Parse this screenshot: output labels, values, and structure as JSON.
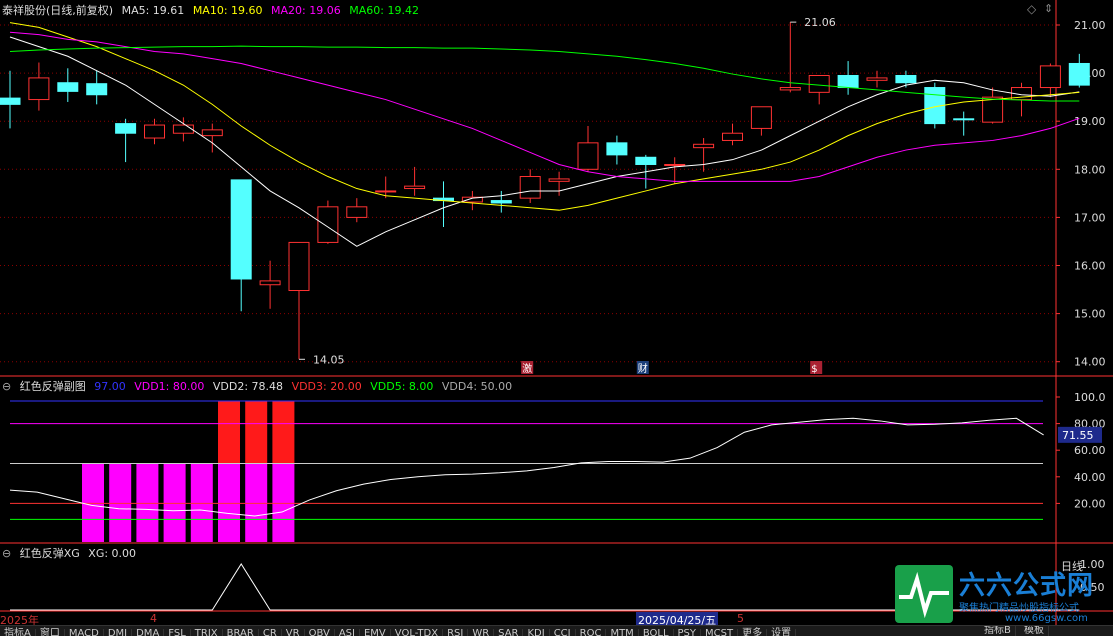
{
  "main_header": {
    "stock": "泰祥股份(日线,前复权)",
    "ma5": "MA5: 19.61",
    "ma10": "MA10: 19.60",
    "ma20": "MA20: 19.06",
    "ma60": "MA60: 19.42"
  },
  "sub1_header": {
    "name": "红色反弹副图",
    "ind1": "97.00",
    "vdd1": "VDD1: 80.00",
    "vdd2": "VDD2: 78.48",
    "vdd3": "VDD3: 20.00",
    "vdd5": "VDD5: 8.00",
    "vdd4": "VDD4: 50.00"
  },
  "sub2_header": {
    "name": "红色反弹XG",
    "xg": "XG: 0.00"
  },
  "colors": {
    "up": "#ff3232",
    "down": "#54ffff",
    "ma5": "#ffffff",
    "ma10": "#ffff00",
    "ma20": "#ff00ff",
    "ma60": "#00ff00",
    "grid": "#8b0000",
    "axis": "#ff3232"
  },
  "chart_data": [
    {
      "type": "candlestick",
      "title": "泰祥股份(日线,前复权)",
      "ylim": [
        13.8,
        21.3
      ],
      "y_ticks": [
        "21.00",
        "20.00",
        "19.00",
        "18.00",
        "17.00",
        "16.00",
        "15.00",
        "14.00"
      ],
      "candles": [
        {
          "o": 19.48,
          "h": 20.05,
          "l": 18.85,
          "c": 19.35
        },
        {
          "o": 19.45,
          "h": 20.22,
          "l": 19.22,
          "c": 19.9
        },
        {
          "o": 19.8,
          "h": 20.1,
          "l": 19.4,
          "c": 19.62
        },
        {
          "o": 19.78,
          "h": 20.05,
          "l": 19.35,
          "c": 19.55
        },
        {
          "o": 18.95,
          "h": 19.05,
          "l": 18.15,
          "c": 18.75
        },
        {
          "o": 18.65,
          "h": 19.05,
          "l": 18.52,
          "c": 18.92
        },
        {
          "o": 18.75,
          "h": 19.08,
          "l": 18.58,
          "c": 18.92
        },
        {
          "o": 18.7,
          "h": 18.95,
          "l": 18.35,
          "c": 18.82
        },
        {
          "o": 17.78,
          "h": 17.78,
          "l": 15.05,
          "c": 15.72
        },
        {
          "o": 15.6,
          "h": 16.1,
          "l": 15.1,
          "c": 15.68
        },
        {
          "o": 15.48,
          "h": 16.4,
          "l": 14.05,
          "c": 16.48
        },
        {
          "o": 16.48,
          "h": 17.35,
          "l": 16.45,
          "c": 17.22
        },
        {
          "o": 17.0,
          "h": 17.4,
          "l": 16.9,
          "c": 17.22
        },
        {
          "o": 17.55,
          "h": 17.85,
          "l": 17.4,
          "c": 17.55
        },
        {
          "o": 17.6,
          "h": 18.05,
          "l": 17.45,
          "c": 17.65
        },
        {
          "o": 17.4,
          "h": 17.75,
          "l": 16.8,
          "c": 17.35
        },
        {
          "o": 17.32,
          "h": 17.55,
          "l": 17.15,
          "c": 17.42
        },
        {
          "o": 17.35,
          "h": 17.55,
          "l": 17.1,
          "c": 17.3
        },
        {
          "o": 17.4,
          "h": 18.0,
          "l": 17.3,
          "c": 17.85
        },
        {
          "o": 17.75,
          "h": 17.95,
          "l": 17.45,
          "c": 17.8
        },
        {
          "o": 18.0,
          "h": 18.9,
          "l": 17.95,
          "c": 18.55
        },
        {
          "o": 18.55,
          "h": 18.7,
          "l": 18.1,
          "c": 18.3
        },
        {
          "o": 18.25,
          "h": 18.3,
          "l": 17.6,
          "c": 18.1
        },
        {
          "o": 18.1,
          "h": 18.25,
          "l": 17.7,
          "c": 18.1
        },
        {
          "o": 18.45,
          "h": 18.65,
          "l": 17.95,
          "c": 18.52
        },
        {
          "o": 18.6,
          "h": 18.95,
          "l": 18.5,
          "c": 18.75
        },
        {
          "o": 18.85,
          "h": 19.3,
          "l": 18.7,
          "c": 19.3
        },
        {
          "o": 19.65,
          "h": 21.06,
          "l": 19.6,
          "c": 19.7
        },
        {
          "o": 19.6,
          "h": 19.9,
          "l": 19.35,
          "c": 19.95
        },
        {
          "o": 19.95,
          "h": 20.25,
          "l": 19.55,
          "c": 19.7
        },
        {
          "o": 19.85,
          "h": 20.05,
          "l": 19.7,
          "c": 19.9
        },
        {
          "o": 19.95,
          "h": 20.05,
          "l": 19.7,
          "c": 19.8
        },
        {
          "o": 19.7,
          "h": 19.8,
          "l": 18.85,
          "c": 18.95
        },
        {
          "o": 19.05,
          "h": 19.2,
          "l": 18.7,
          "c": 19.03
        },
        {
          "o": 18.98,
          "h": 19.7,
          "l": 18.95,
          "c": 19.5
        },
        {
          "o": 19.45,
          "h": 19.8,
          "l": 19.1,
          "c": 19.7
        },
        {
          "o": 19.7,
          "h": 20.2,
          "l": 19.5,
          "c": 20.15
        },
        {
          "o": 20.2,
          "h": 20.4,
          "l": 19.7,
          "c": 19.75
        }
      ],
      "series": [
        {
          "name": "MA5",
          "values": [
            20.75,
            20.55,
            20.35,
            20.05,
            19.75,
            19.35,
            18.95,
            18.55,
            18.05,
            17.55,
            17.2,
            16.8,
            16.4,
            16.7,
            16.95,
            17.2,
            17.4,
            17.45,
            17.55,
            17.55,
            17.7,
            17.85,
            17.95,
            18.05,
            18.1,
            18.2,
            18.4,
            18.7,
            19.0,
            19.3,
            19.55,
            19.75,
            19.85,
            19.8,
            19.65,
            19.55,
            19.52,
            19.61
          ]
        },
        {
          "name": "MA10",
          "values": [
            21.05,
            20.95,
            20.75,
            20.55,
            20.3,
            20.05,
            19.75,
            19.35,
            18.9,
            18.5,
            18.15,
            17.85,
            17.6,
            17.45,
            17.4,
            17.35,
            17.3,
            17.25,
            17.2,
            17.15,
            17.25,
            17.4,
            17.55,
            17.7,
            17.8,
            17.9,
            18.0,
            18.15,
            18.4,
            18.7,
            18.95,
            19.15,
            19.3,
            19.4,
            19.45,
            19.5,
            19.55,
            19.6
          ]
        },
        {
          "name": "MA20",
          "values": [
            20.85,
            20.8,
            20.7,
            20.65,
            20.55,
            20.45,
            20.4,
            20.3,
            20.2,
            20.05,
            19.9,
            19.75,
            19.6,
            19.45,
            19.25,
            19.05,
            18.85,
            18.6,
            18.35,
            18.1,
            17.95,
            17.85,
            17.8,
            17.75,
            17.75,
            17.75,
            17.75,
            17.75,
            17.85,
            18.05,
            18.25,
            18.4,
            18.5,
            18.55,
            18.6,
            18.7,
            18.85,
            19.06
          ]
        },
        {
          "name": "MA60",
          "values": [
            20.45,
            20.48,
            20.5,
            20.52,
            20.53,
            20.54,
            20.55,
            20.55,
            20.56,
            20.55,
            20.55,
            20.54,
            20.54,
            20.53,
            20.53,
            20.52,
            20.52,
            20.5,
            20.48,
            20.45,
            20.4,
            20.35,
            20.28,
            20.2,
            20.1,
            19.98,
            19.88,
            19.8,
            19.75,
            19.7,
            19.65,
            19.6,
            19.55,
            19.5,
            19.46,
            19.44,
            19.42,
            19.42
          ]
        }
      ],
      "annotations": {
        "max": "21.06",
        "min": "14.05"
      },
      "event_marks": [
        {
          "index": 18,
          "label": "激"
        },
        {
          "index": 22,
          "label": "财"
        },
        {
          "index": 28,
          "label": "$"
        }
      ]
    },
    {
      "type": "bar",
      "title": "红色反弹副图",
      "ylim": [
        0,
        100
      ],
      "y_ticks": [
        "100.0",
        "80.00",
        "60.00",
        "40.00",
        "20.00"
      ],
      "levels": [
        {
          "name": "VDD1",
          "value": 80,
          "color": "#ff00ff"
        },
        {
          "name": "VDD3",
          "value": 20,
          "color": "#ff3232"
        },
        {
          "name": "VDD5",
          "value": 8,
          "color": "#00ff00"
        },
        {
          "name": "VDD4",
          "value": 50,
          "color": "#cccccc"
        },
        {
          "name": "top",
          "value": 97,
          "color": "#3333ff"
        }
      ],
      "magenta_bars_idx": [
        3,
        4,
        5,
        6,
        7,
        8,
        9,
        10
      ],
      "magenta_value": 50,
      "red_bars_idx": [
        8,
        9,
        10
      ],
      "red_from": 50,
      "red_to": 97,
      "line_values": [
        30.0,
        28.5,
        23.5,
        18.5,
        16.0,
        15.5,
        14.5,
        15.0,
        12.5,
        10.5,
        13.5,
        22.5,
        29.5,
        34.5,
        38.0,
        40.0,
        41.5,
        42.0,
        43.0,
        44.5,
        47.0,
        50.5,
        51.5,
        51.5,
        51.0,
        54.0,
        62.0,
        73.5,
        79.0,
        81.0,
        83.0,
        84.0,
        82.0,
        79.0,
        79.5,
        80.5,
        82.5,
        84.0,
        71.5
      ],
      "current_value": "71.55"
    },
    {
      "type": "line",
      "title": "红色反弹XG",
      "ylim": [
        0,
        1.0
      ],
      "y_ticks": [
        "1.00",
        "0.50"
      ],
      "values": [
        0,
        0,
        0,
        0,
        0,
        0,
        0,
        0,
        1,
        0,
        0,
        0,
        0,
        0,
        0,
        0,
        0,
        0,
        0,
        0,
        0,
        0,
        0,
        0,
        0,
        0,
        0,
        0,
        0,
        0,
        0,
        0,
        0,
        0,
        0,
        0,
        0,
        0
      ]
    }
  ],
  "date_bar": {
    "year": "2025年",
    "m4": "4",
    "selected": "2025/04/25/五",
    "m5": "5"
  },
  "right_labels": {
    "period": "日线"
  },
  "tabs": [
    "指标A",
    "窗口",
    "MACD",
    "DMI",
    "DMA",
    "FSL",
    "TRIX",
    "BRAR",
    "CR",
    "VR",
    "OBV",
    "ASI",
    "EMV",
    "VOL-TDX",
    "RSI",
    "WR",
    "SAR",
    "KDJ",
    "CCI",
    "ROC",
    "MTM",
    "BOLL",
    "PSY",
    "MCST",
    "更多",
    "设置"
  ],
  "tabs_right": [
    "指标B",
    "模板"
  ],
  "logo": {
    "text": "六六公式网",
    "sub": "聚焦热门精品炒股指标公式",
    "url": "www.66gsw.com"
  }
}
